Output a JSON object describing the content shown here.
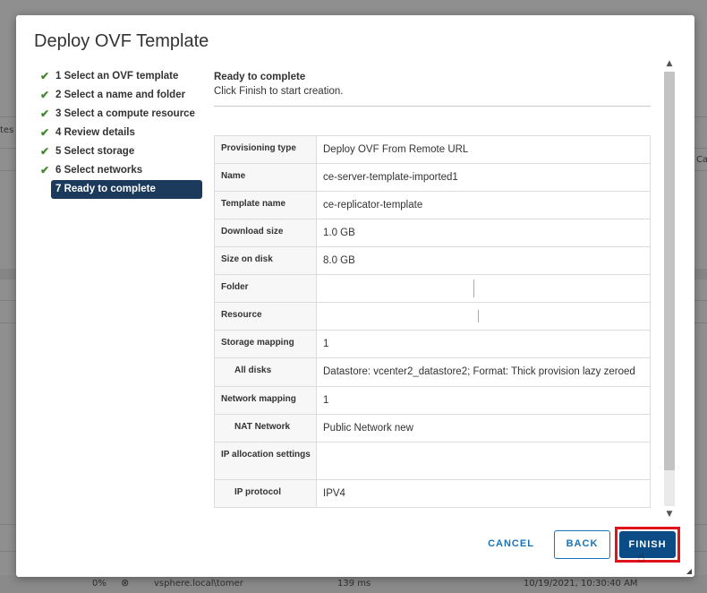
{
  "dialog": {
    "title": "Deploy OVF Template",
    "steps": [
      {
        "label": "1 Select an OVF template",
        "state": "done"
      },
      {
        "label": "2 Select a name and folder",
        "state": "done"
      },
      {
        "label": "3 Select a compute resource",
        "state": "done"
      },
      {
        "label": "4 Review details",
        "state": "done"
      },
      {
        "label": "5 Select storage",
        "state": "done"
      },
      {
        "label": "6 Select networks",
        "state": "done"
      },
      {
        "label": "7 Ready to complete",
        "state": "active"
      }
    ],
    "content": {
      "heading": "Ready to complete",
      "subheading": "Click Finish to start creation.",
      "rows": [
        {
          "key": "Provisioning type",
          "value": "Deploy OVF From Remote URL"
        },
        {
          "key": "Name",
          "value": "ce-server-template-imported1"
        },
        {
          "key": "Template name",
          "value": "ce-replicator-template"
        },
        {
          "key": "Download size",
          "value": "1.0 GB"
        },
        {
          "key": "Size on disk",
          "value": "8.0 GB"
        },
        {
          "key": "Folder",
          "value": ""
        },
        {
          "key": "Resource",
          "value": ""
        },
        {
          "key": "Storage mapping",
          "value": "1"
        },
        {
          "key": "All disks",
          "value": "Datastore: vcenter2_datastore2; Format: Thick provision lazy zeroed"
        },
        {
          "key": "Network mapping",
          "value": "1"
        },
        {
          "key": "NAT Network",
          "value": "Public Network new"
        },
        {
          "key": "IP allocation settings",
          "value": ""
        },
        {
          "key": "IP protocol",
          "value": "IPV4"
        }
      ]
    },
    "buttons": {
      "cancel": "CANCEL",
      "back": "BACK",
      "finish": "FINISH"
    }
  },
  "background": {
    "fragments": [
      "tes",
      "Ca",
      "0%",
      "vsphere.local\\tomer",
      "139 ms",
      "10/19/2021, 10:30:40 AM"
    ]
  },
  "colors": {
    "accent": "#0b4c86",
    "check": "#3f8a2c",
    "highlight": "#e0121b"
  },
  "icons": {
    "check": "check-icon",
    "scroll_up": "chevron-up-icon",
    "scroll_down": "chevron-down-icon",
    "cursor": "mouse-pointer-icon"
  }
}
